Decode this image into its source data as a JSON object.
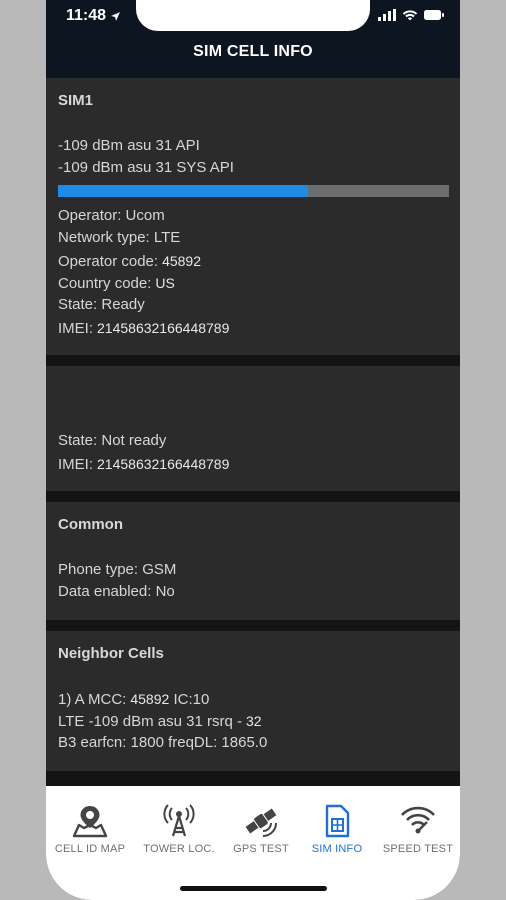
{
  "status_bar": {
    "time": "11:48"
  },
  "header": {
    "title": "SIM CELL INFO"
  },
  "sim1": {
    "title": "SIM1",
    "signal_api": "-109 dBm asu 31 API",
    "signal_sys": "-109 dBm asu 31 SYS API",
    "signal_level": 0.64,
    "operator": "Operator: Ucom",
    "network_type": "Network type: LTE",
    "operator_code_label": "Operator code:",
    "operator_code": "45892",
    "country_code_label": "Country code:",
    "country_code": "US",
    "state": "State: Ready",
    "imei_label": "IMEI:",
    "imei": "21458632166448789"
  },
  "sim2": {
    "state": "State: Not ready",
    "imei_label": "IMEI:",
    "imei": "21458632166448789"
  },
  "common": {
    "title": "Common",
    "phone_type": "Phone type: GSM",
    "data_enabled": "Data enabled: No"
  },
  "neighbor": {
    "title": "Neighbor Cells",
    "line1_prefix": "1) A  MCC:",
    "line1_mcc": "45892",
    "line1_suffix": "  IC:10",
    "line2_prefix": "LTE -109 dBm asu 31 rsrq -",
    "line2_value": "32",
    "line3": "B3 earfcn: 1800 freqDL: 1865.0"
  },
  "nav": {
    "items": [
      {
        "label": "CELL ID MAP",
        "icon": "map-pin-icon"
      },
      {
        "label": "TOWER LOC.",
        "icon": "tower-icon"
      },
      {
        "label": "GPS TEST",
        "icon": "satellite-icon"
      },
      {
        "label": "SIM INFO",
        "icon": "sim-card-icon",
        "active": true
      },
      {
        "label": "SPEED TEST",
        "icon": "wifi-speed-icon"
      }
    ]
  },
  "colors": {
    "accent": "#1e8be6",
    "active_tab": "#1f6fd8",
    "header": "#0d1520"
  }
}
